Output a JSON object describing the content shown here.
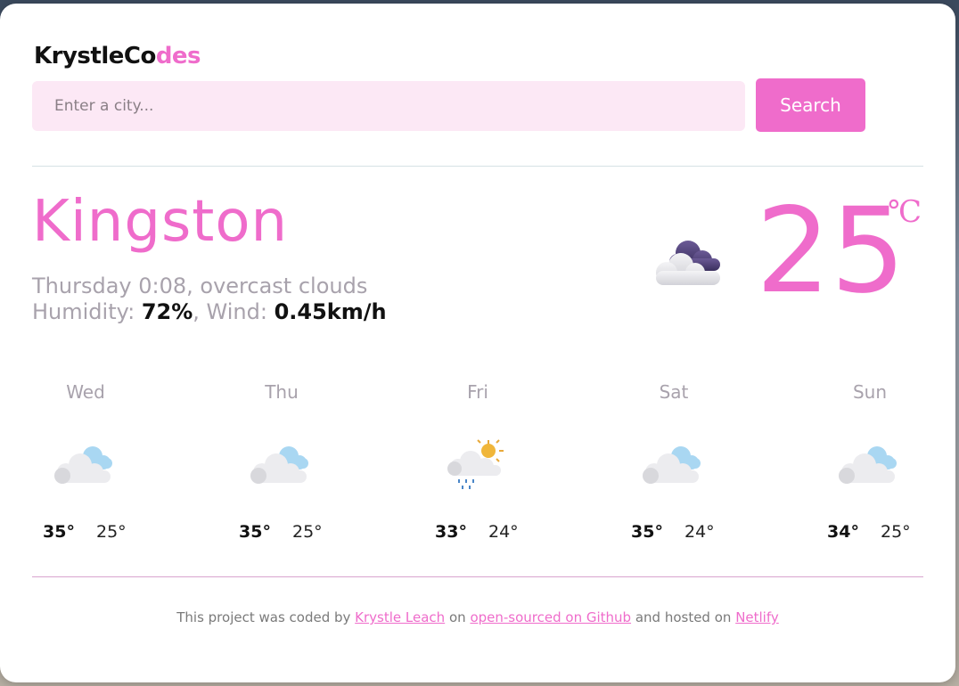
{
  "logo": {
    "part1": "KrystleCo",
    "part2": "des"
  },
  "search": {
    "placeholder": "Enter a city...",
    "button_label": "Search"
  },
  "current": {
    "city": "Kingston",
    "day_time": "Thursday 0:08",
    "description": "overcast clouds",
    "humidity_label": "Humidity:",
    "humidity_value": "72%",
    "wind_label": "Wind:",
    "wind_value": "0.45km/h",
    "temperature": "25",
    "unit": "℃",
    "icon": "overcast-clouds-icon"
  },
  "forecast": [
    {
      "day": "Wed",
      "max": "35°",
      "min": "25°",
      "icon": "partly-cloudy-icon"
    },
    {
      "day": "Thu",
      "max": "35°",
      "min": "25°",
      "icon": "partly-cloudy-icon"
    },
    {
      "day": "Fri",
      "max": "33°",
      "min": "24°",
      "icon": "sun-rain-cloud-icon"
    },
    {
      "day": "Sat",
      "max": "35°",
      "min": "24°",
      "icon": "partly-cloudy-icon"
    },
    {
      "day": "Sun",
      "max": "34°",
      "min": "25°",
      "icon": "partly-cloudy-icon"
    }
  ],
  "footer": {
    "text1": "This project was coded by",
    "link1": "Krystle Leach",
    "text2": "on",
    "link2": "open-sourced on Github",
    "text3": "and hosted on",
    "link3": "Netlify"
  },
  "colors": {
    "accent": "#ef6ccb",
    "input_bg": "#fce8f5",
    "muted_text": "#a8a2ac"
  }
}
